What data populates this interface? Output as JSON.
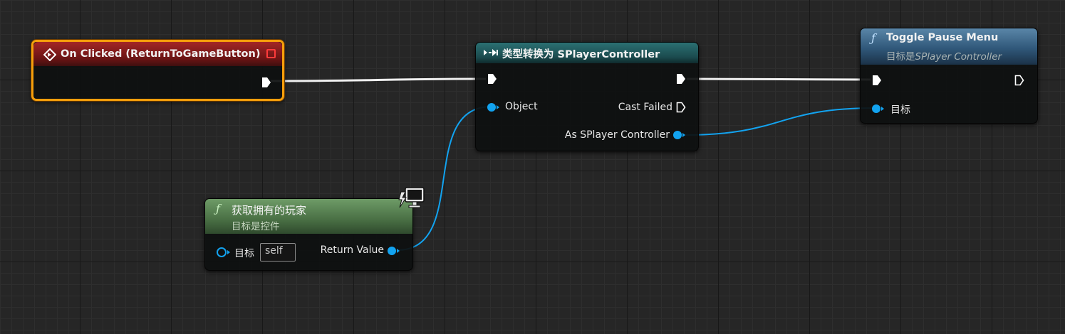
{
  "colors": {
    "event_header": "#8a1c1c",
    "cast_header": "#1e5659",
    "pure_header": "#4e7a4b",
    "func_header": "#2a4f6c",
    "object_pin": "#12a3f0",
    "wire_exec": "#f0f0f0",
    "selection": "#f59e0b"
  },
  "nodes": {
    "on_clicked": {
      "title": "On Clicked (ReturnToGameButton)",
      "icon": "event-diamond-icon",
      "badge_icon": "stop-square-icon"
    },
    "cast": {
      "title": "类型转换为 SPlayerController",
      "icon": "cast-arrows-icon",
      "pins": {
        "object": "Object",
        "cast_failed": "Cast Failed",
        "as_player": "As SPlayer Controller"
      }
    },
    "get_owning_player": {
      "function_glyph": "ƒ",
      "title": "获取拥有的玩家",
      "subtitle": "目标是控件",
      "badge_icon": "client-monitor-icon",
      "pins": {
        "target": "目标",
        "target_value": "self",
        "return_value": "Return Value"
      }
    },
    "toggle_pause": {
      "function_glyph": "ƒ",
      "title": "Toggle Pause Menu",
      "subtitle_prefix": "目标是",
      "subtitle_class": "SPlayer Controller",
      "pins": {
        "target": "目标"
      }
    }
  }
}
